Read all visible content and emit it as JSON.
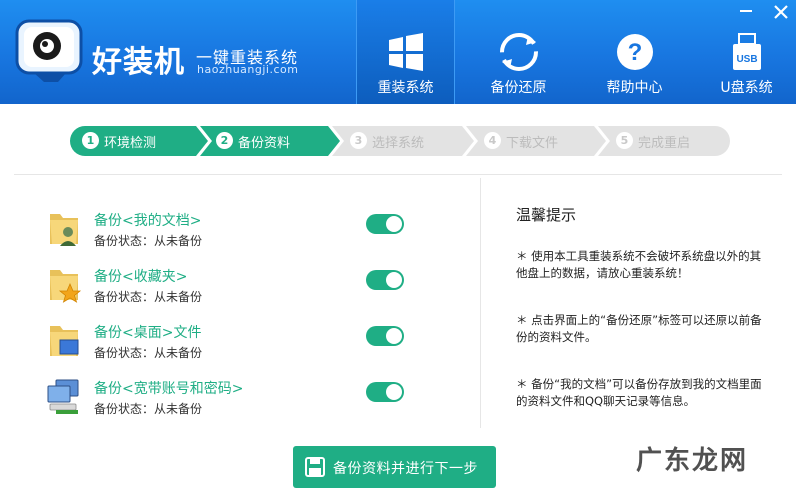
{
  "header": {
    "brand": "好装机",
    "slogan": "一键重装系统",
    "url": "haozhuangji.com"
  },
  "nav": [
    {
      "label": "重装系统",
      "icon": "windows-icon",
      "active": true
    },
    {
      "label": "备份还原",
      "icon": "refresh-icon",
      "active": false
    },
    {
      "label": "帮助中心",
      "icon": "help-icon",
      "active": false
    },
    {
      "label": "U盘系统",
      "icon": "usb-icon",
      "active": false
    }
  ],
  "steps": [
    {
      "num": "1",
      "label": "环境检测",
      "state": "done"
    },
    {
      "num": "2",
      "label": "备份资料",
      "state": "done"
    },
    {
      "num": "3",
      "label": "选择系统",
      "state": "todo"
    },
    {
      "num": "4",
      "label": "下载文件",
      "state": "todo"
    },
    {
      "num": "5",
      "label": "完成重启",
      "state": "todo"
    }
  ],
  "backups": [
    {
      "title": "备份<我的文档>",
      "status": "备份状态：从未备份",
      "icon": "documents-folder-icon",
      "enabled": true
    },
    {
      "title": "备份<收藏夹>",
      "status": "备份状态：从未备份",
      "icon": "favorites-folder-icon",
      "enabled": true
    },
    {
      "title": "备份<桌面>文件",
      "status": "备份状态：从未备份",
      "icon": "desktop-folder-icon",
      "enabled": true
    },
    {
      "title": "备份<宽带账号和密码>",
      "status": "备份状态：从未备份",
      "icon": "network-icon",
      "enabled": true
    }
  ],
  "tips": {
    "title": "温馨提示",
    "items": [
      "＊ 使用本工具重装系统不会破坏系统盘以外的其他盘上的数据，请放心重装系统！",
      "＊ 点击界面上的“备份还原”标签可以还原以前备份的资料文件。",
      "＊ 备份“我的文档”可以备份存放到我的文档里面的资料文件和QQ聊天记录等信息。"
    ]
  },
  "primary_button": "备份资料并进行下一步",
  "watermark": "广东龙网",
  "colors": {
    "header_blue": "#1876e0",
    "accent_green": "#1fae85",
    "step_inactive": "#e3e3e3"
  }
}
